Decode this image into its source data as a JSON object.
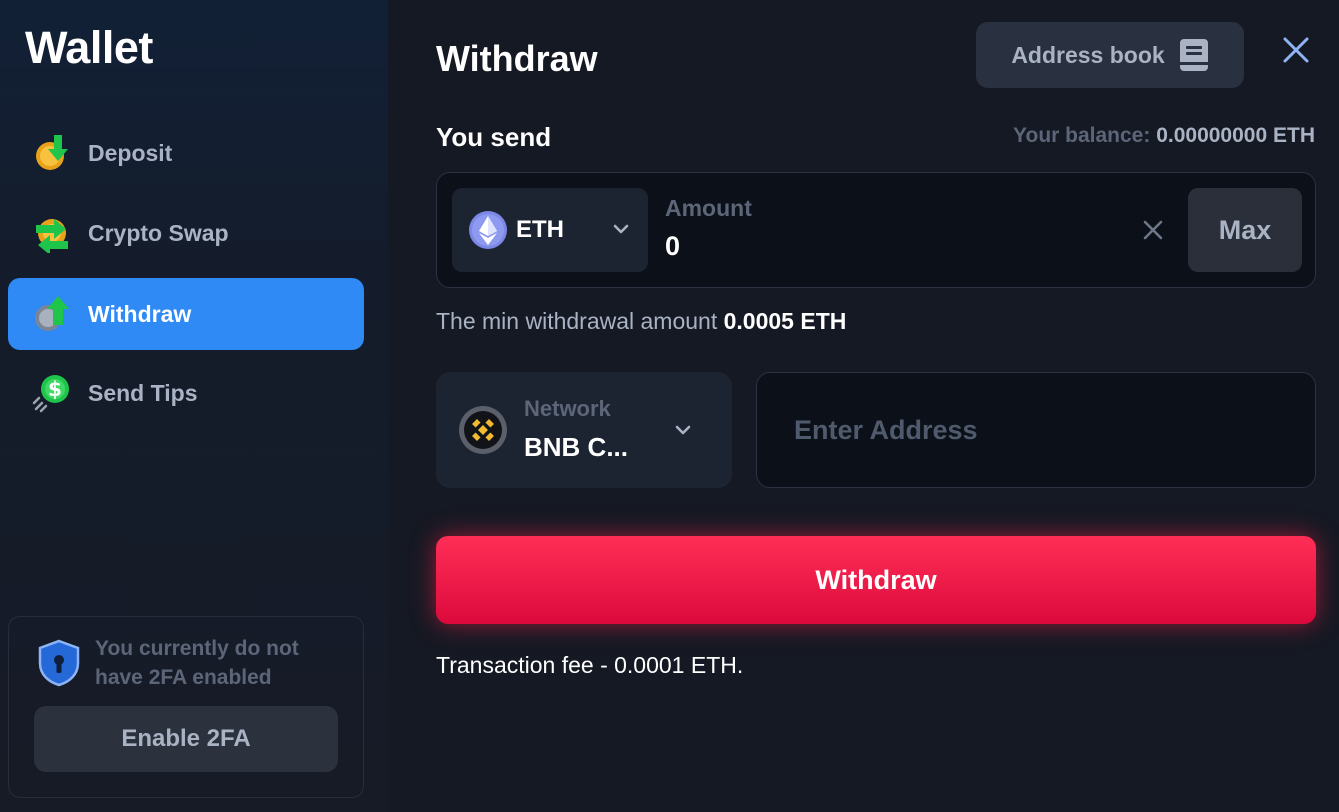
{
  "sidebar": {
    "title": "Wallet",
    "items": [
      {
        "label": "Deposit",
        "icon": "deposit-icon"
      },
      {
        "label": "Crypto Swap",
        "icon": "swap-icon"
      },
      {
        "label": "Withdraw",
        "icon": "withdraw-icon",
        "active": true
      },
      {
        "label": "Send Tips",
        "icon": "tips-icon"
      }
    ],
    "twofa": {
      "message": "You currently do not have 2FA enabled",
      "button_label": "Enable 2FA",
      "icon": "shield-lock-icon"
    }
  },
  "main": {
    "title": "Withdraw",
    "address_book_label": "Address book",
    "you_send_label": "You send",
    "balance_label": "Your balance:",
    "balance_value": "0.00000000 ETH",
    "coin": "ETH",
    "amount_label": "Amount",
    "amount_value": "0",
    "max_label": "Max",
    "min_label": "The min withdrawal amount",
    "min_value": "0.0005 ETH",
    "network_label": "Network",
    "network_value": "BNB C...",
    "address_placeholder": "Enter Address",
    "withdraw_label": "Withdraw",
    "fee_note": "Transaction fee - 0.0001 ETH."
  },
  "colors": {
    "accent_blue": "#2f8af5",
    "withdraw_red": "#ff2e56",
    "background": "#151923"
  }
}
